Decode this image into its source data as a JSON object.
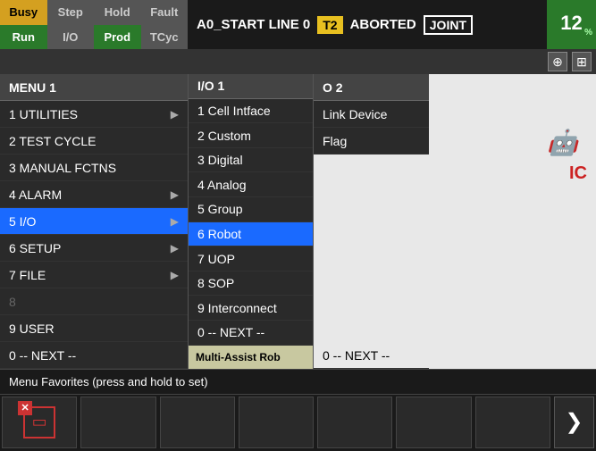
{
  "topBar": {
    "buttons": {
      "row1": [
        "Busy",
        "Step",
        "Hold",
        "Fault"
      ],
      "row2": [
        "Run",
        "I/O",
        "Prod",
        "TCyc"
      ]
    },
    "statusText": "A0_START LINE 0",
    "tag": "T2",
    "statusAborted": "ABORTED",
    "modeTag": "JOINT",
    "percent": "12",
    "percentSign": "%"
  },
  "menu1": {
    "header": "MENU  1",
    "items": [
      {
        "num": "1",
        "label": "UTILITIES",
        "hasArrow": true,
        "active": false,
        "disabled": false
      },
      {
        "num": "2",
        "label": "TEST CYCLE",
        "hasArrow": false,
        "active": false,
        "disabled": false
      },
      {
        "num": "3",
        "label": "MANUAL FCTNS",
        "hasArrow": false,
        "active": false,
        "disabled": false
      },
      {
        "num": "4",
        "label": "ALARM",
        "hasArrow": true,
        "active": false,
        "disabled": false
      },
      {
        "num": "5",
        "label": "I/O",
        "hasArrow": true,
        "active": true,
        "disabled": false
      },
      {
        "num": "6",
        "label": "SETUP",
        "hasArrow": true,
        "active": false,
        "disabled": false
      },
      {
        "num": "7",
        "label": "FILE",
        "hasArrow": true,
        "active": false,
        "disabled": false
      },
      {
        "num": "8",
        "label": "",
        "hasArrow": false,
        "active": false,
        "disabled": true
      },
      {
        "num": "9",
        "label": "USER",
        "hasArrow": false,
        "active": false,
        "disabled": false
      },
      {
        "num": "0",
        "label": "-- NEXT --",
        "hasArrow": false,
        "active": false,
        "disabled": false
      }
    ]
  },
  "io1": {
    "header": "I/O  1",
    "items": [
      {
        "num": "1",
        "label": "Cell Intface",
        "active": false
      },
      {
        "num": "2",
        "label": "Custom",
        "active": false
      },
      {
        "num": "3",
        "label": "Digital",
        "active": false
      },
      {
        "num": "4",
        "label": "Analog",
        "active": false
      },
      {
        "num": "5",
        "label": "Group",
        "active": false
      },
      {
        "num": "6",
        "label": "Robot",
        "active": true
      },
      {
        "num": "7",
        "label": "UOP",
        "active": false
      },
      {
        "num": "8",
        "label": "SOP",
        "active": false
      },
      {
        "num": "9",
        "label": "Interconnect",
        "active": false
      },
      {
        "num": "0",
        "label": "-- NEXT --",
        "active": false
      }
    ],
    "multiAssist": "Multi-Assist Rob"
  },
  "io2": {
    "header": "O  2",
    "items": [
      {
        "label": "Link Device",
        "active": false
      },
      {
        "label": "Flag",
        "active": false
      }
    ],
    "nextLabel": "0 -- NEXT --"
  },
  "bottomStatus": "Menu Favorites (press and hold to set)",
  "bottomToolbar": {
    "buttons": [
      "",
      "",
      "",
      "",
      "",
      "",
      ""
    ],
    "nextLabel": "❯"
  }
}
